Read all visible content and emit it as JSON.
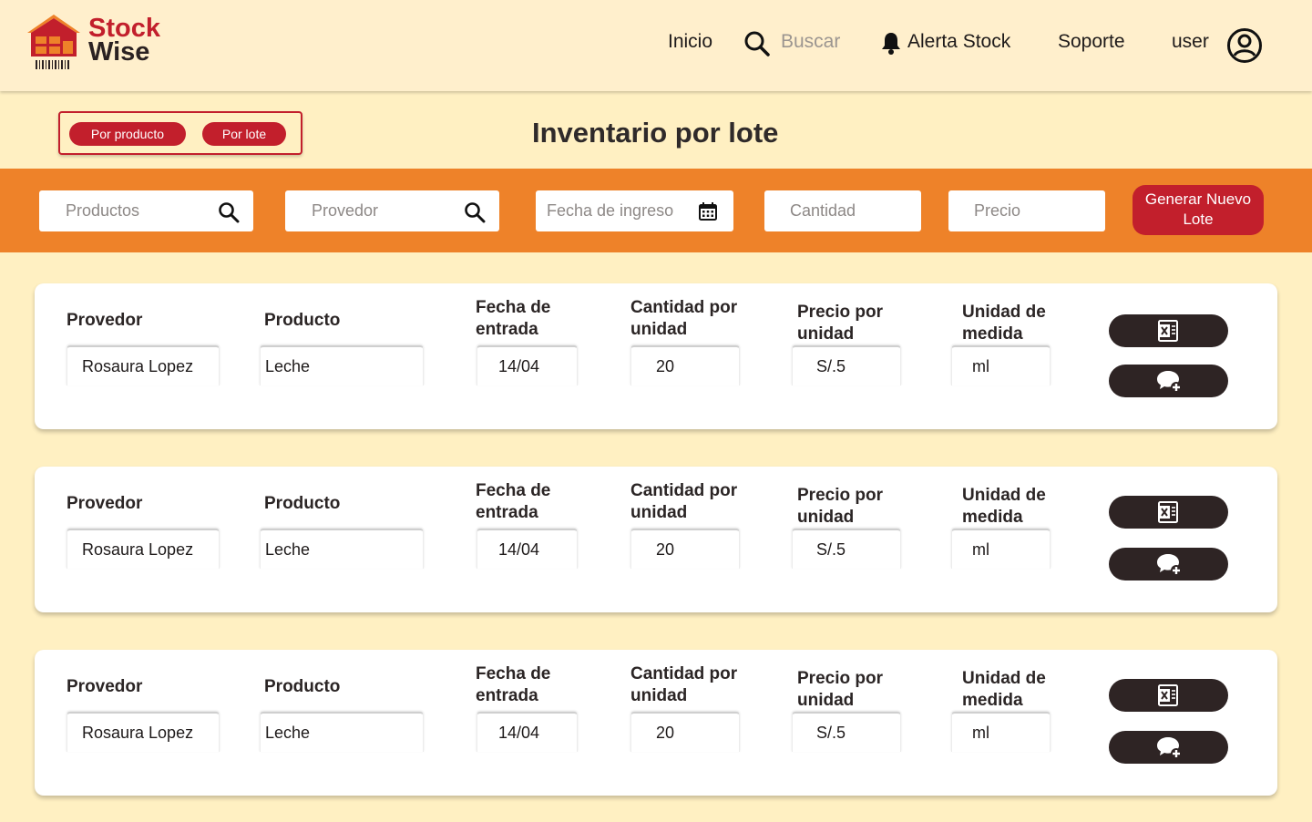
{
  "brand": {
    "line1": "Stock",
    "line2": "Wise"
  },
  "nav": {
    "home": "Inicio",
    "search_placeholder": "Buscar",
    "alerts": "Alerta Stock",
    "support": "Soporte",
    "user": "user"
  },
  "view_toggle": {
    "by_product": "Por producto",
    "by_batch": "Por lote"
  },
  "page_title": "Inventario por lote",
  "filters": {
    "products": "Productos",
    "supplier": "Provedor",
    "entry_date": "Fecha de ingreso",
    "quantity": "Cantidad",
    "price": "Precio",
    "generate_button": "Generar Nuevo Lote"
  },
  "labels": {
    "supplier": "Provedor",
    "product": "Producto",
    "entry_date": "Fecha de entrada",
    "qty_per_unit": "Cantidad por unidad",
    "price_per_unit": "Precio por unidad",
    "unit": "Unidad de medida"
  },
  "batches": [
    {
      "supplier": "Rosaura Lopez",
      "product": "Leche",
      "entry_date": "14/04",
      "qty": "20",
      "price": "S/.5",
      "unit": "ml"
    },
    {
      "supplier": "Rosaura Lopez",
      "product": "Leche",
      "entry_date": "14/04",
      "qty": "20",
      "price": "S/.5",
      "unit": "ml"
    },
    {
      "supplier": "Rosaura Lopez",
      "product": "Leche",
      "entry_date": "14/04",
      "qty": "20",
      "price": "S/.5",
      "unit": "ml"
    }
  ],
  "colors": {
    "background": "#FFF0C2",
    "header": "#FFEFCC",
    "accent_orange": "#EE8229",
    "brand_red": "#C21F2C",
    "dark_button": "#2E2424"
  },
  "icons": {
    "search": "search-icon",
    "bell": "bell-icon",
    "user": "user-circle-icon",
    "calendar": "calendar-icon",
    "excel": "excel-export-icon",
    "comment": "add-comment-icon"
  }
}
